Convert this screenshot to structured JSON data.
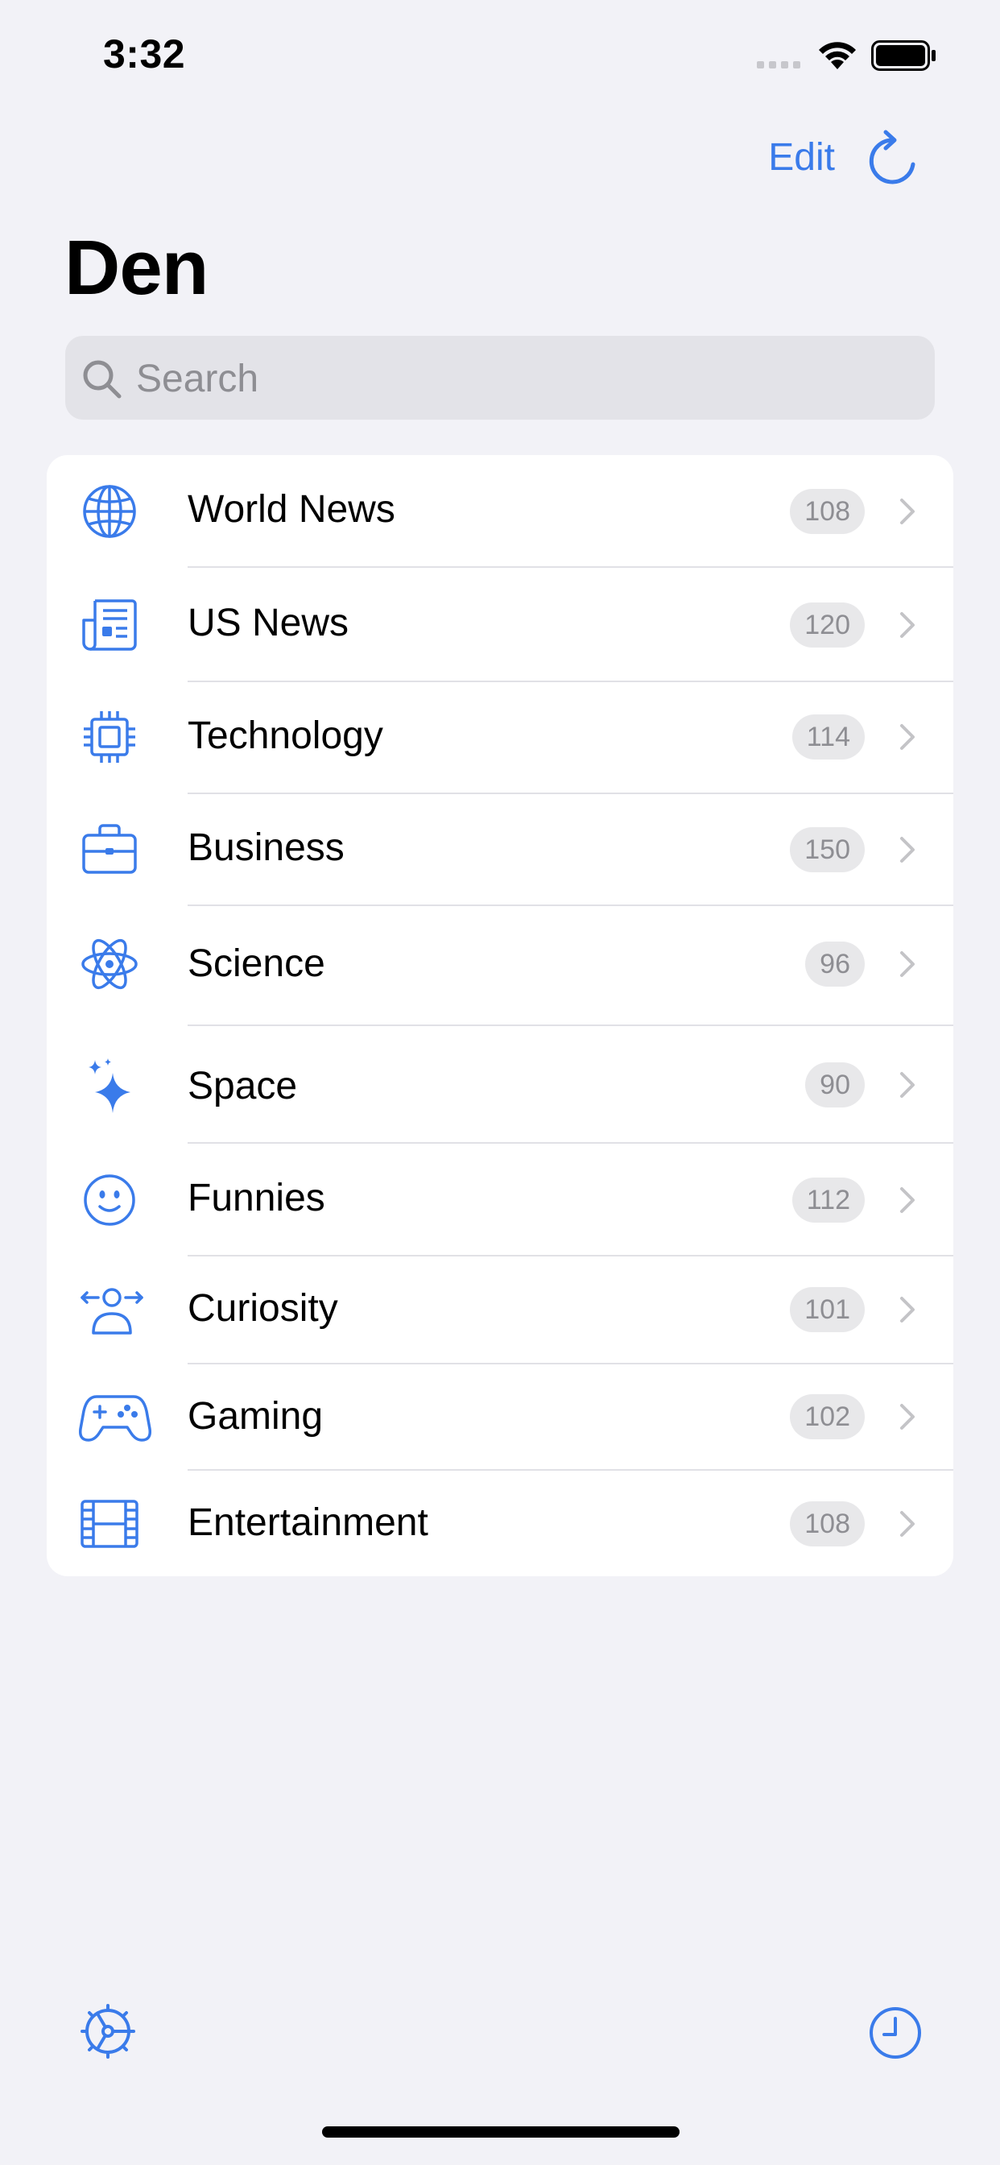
{
  "status_bar": {
    "time": "3:32"
  },
  "nav": {
    "edit_label": "Edit"
  },
  "title": "Den",
  "search": {
    "placeholder": "Search",
    "value": ""
  },
  "accent_color": "#3a7bea",
  "categories": [
    {
      "label": "World News",
      "count": "108",
      "icon": "globe-icon"
    },
    {
      "label": "US News",
      "count": "120",
      "icon": "newspaper-icon"
    },
    {
      "label": "Technology",
      "count": "114",
      "icon": "cpu-icon"
    },
    {
      "label": "Business",
      "count": "150",
      "icon": "briefcase-icon"
    },
    {
      "label": "Science",
      "count": "96",
      "icon": "atom-icon"
    },
    {
      "label": "Space",
      "count": "90",
      "icon": "sparkles-icon"
    },
    {
      "label": "Funnies",
      "count": "112",
      "icon": "smiley-icon"
    },
    {
      "label": "Curiosity",
      "count": "101",
      "icon": "person-arrows-icon"
    },
    {
      "label": "Gaming",
      "count": "102",
      "icon": "gamecontroller-icon"
    },
    {
      "label": "Entertainment",
      "count": "108",
      "icon": "film-icon"
    }
  ],
  "toolbar": {
    "left_icon": "gear-icon",
    "right_icon": "clock-icon"
  }
}
